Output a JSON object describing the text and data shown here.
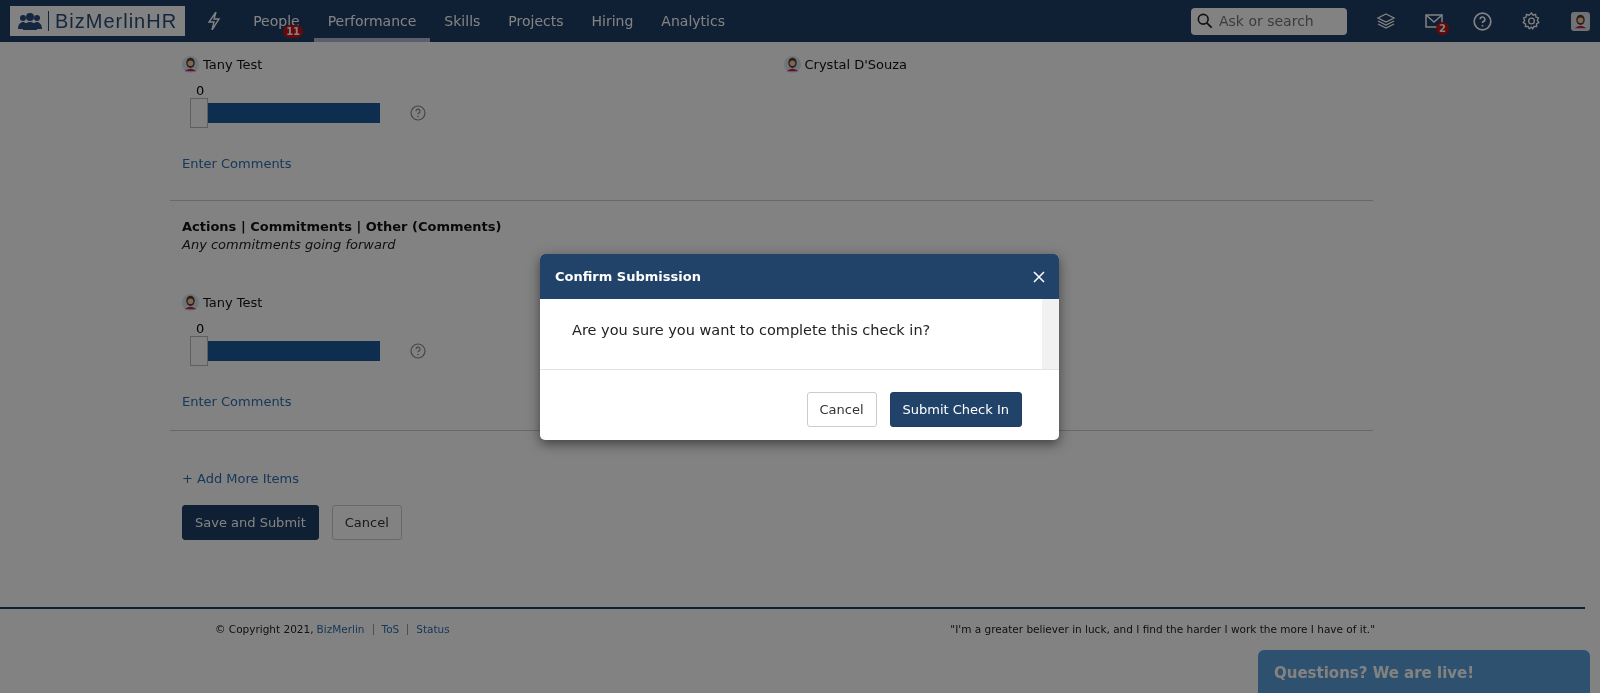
{
  "navbar": {
    "logo": "BizMerlinHR",
    "items": [
      {
        "label": "People",
        "selected": false,
        "badge": "11"
      },
      {
        "label": "Performance",
        "selected": true
      },
      {
        "label": "Skills",
        "selected": false
      },
      {
        "label": "Projects",
        "selected": false
      },
      {
        "label": "Hiring",
        "selected": false
      },
      {
        "label": "Analytics",
        "selected": false
      }
    ],
    "search": {
      "placeholder": "Ask or search"
    },
    "mail_badge": "2"
  },
  "first_section": {
    "reviewers": [
      {
        "name": "Tany Test",
        "reading": "0",
        "level": 0,
        "comment_link": "Enter Comments"
      },
      {
        "name": "Crystal D'Souza"
      }
    ]
  },
  "section": {
    "title": "Actions | Commitments | Other (Comments)",
    "subtitle": "Any commitments going forward",
    "reviewers": [
      {
        "name": "Tany Test",
        "reading": "0",
        "level": 0,
        "comment_link": "Enter Comments"
      }
    ]
  },
  "add_more": "+ Add More Items",
  "buttons": [
    "Save and Submit",
    "Cancel"
  ],
  "footer": {
    "copyright": "© Copyright 2021,",
    "links": [
      "BizMerlin",
      "ToS",
      "Status"
    ],
    "quote": "\"I'm a greater believer in luck, and I find the harder I work the more I have of it.\""
  },
  "chat": "Questions? We are live!",
  "modal": {
    "title": "Confirm Submission",
    "message": "Are you sure you want to complete this check in?",
    "buttons": [
      "Cancel",
      "Submit Check In"
    ]
  }
}
